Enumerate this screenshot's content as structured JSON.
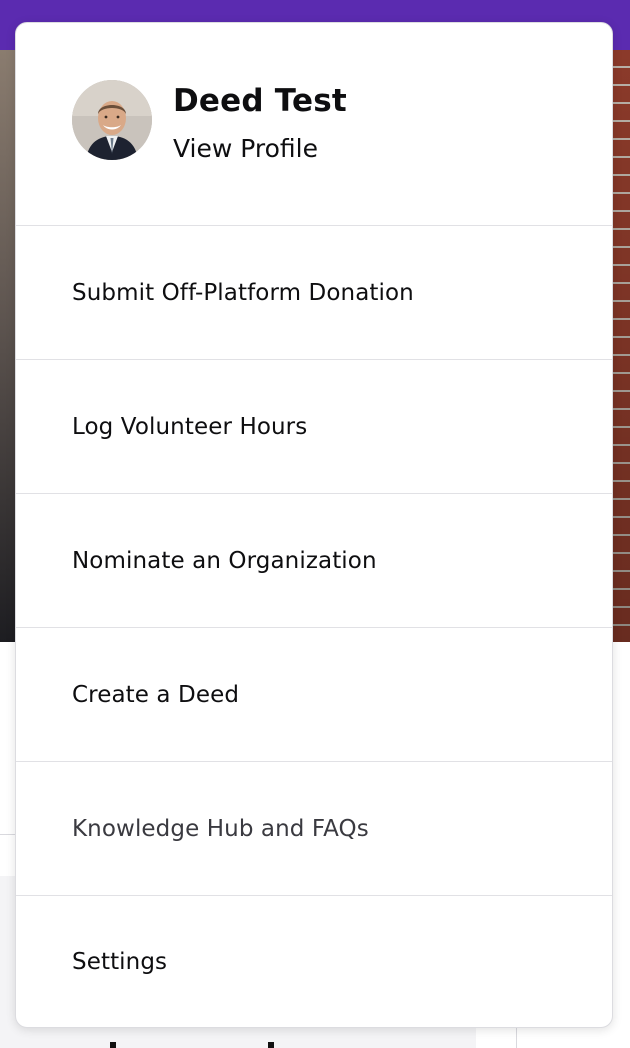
{
  "profile": {
    "name": "Deed Test",
    "link_label": "View Profile"
  },
  "menu": {
    "items": [
      {
        "label": "Submit Off-Platform Donation"
      },
      {
        "label": "Log Volunteer Hours"
      },
      {
        "label": "Nominate an Organization"
      },
      {
        "label": "Create a Deed"
      },
      {
        "label": "Knowledge Hub and FAQs"
      },
      {
        "label": "Settings"
      }
    ]
  },
  "colors": {
    "brand_purple": "#5b2bb0",
    "text": "#0e0e10",
    "divider": "#e1e1e5"
  }
}
